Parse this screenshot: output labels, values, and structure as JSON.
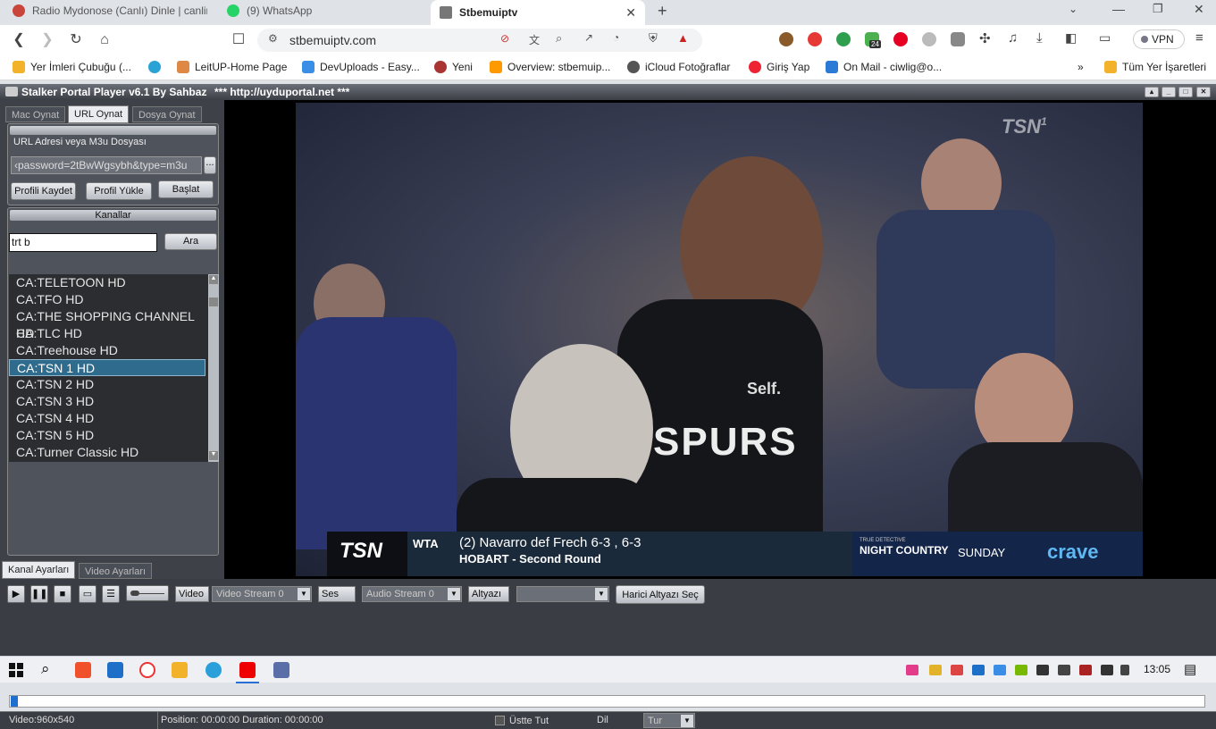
{
  "browser": {
    "tabs": [
      {
        "title": "Radio Mydonose (Canlı) Dinle | canlira",
        "active": false
      },
      {
        "title": "(9) WhatsApp",
        "active": false
      },
      {
        "title": "Stbemuiptv",
        "active": true
      }
    ],
    "url": "stbemuiptv.com",
    "vpn_label": "VPN",
    "badge_count": "24",
    "bookmarks": [
      "Yer İmleri Çubuğu (...",
      "LeitUP-Home Page",
      "DevUploads - Easy...",
      "Yeni",
      "Overview: stbemuip...",
      "iCloud Fotoğraflar",
      "Giriş Yap",
      "On Mail - ciwlig@o..."
    ],
    "bookmarks_more": "»",
    "all_bookmarks": "Tüm Yer İşaretleri"
  },
  "app": {
    "title": "Stalker Portal Player v6.1 By Sahbaz",
    "subtitle": "*** http://uyduportal.net ***",
    "tabs": [
      "Mac Oynat",
      "URL Oynat",
      "Dosya Oynat"
    ],
    "url_section_label": "URL Adresi veya M3u Dosyası",
    "url_value": "‹password=2tBwWgsybh&type=m3u",
    "browse_button": "...",
    "buttons": {
      "save_profile": "Profili Kaydet",
      "load_profile": "Profil Yükle",
      "start": "Başlat"
    },
    "channels_header": "Kanallar",
    "search_value": "trt b",
    "search_button": "Ara",
    "channels": [
      "CA:TELETOON HD",
      "CA:TFO HD",
      "CA:THE SHOPPING CHANNEL HD",
      "CA:TLC HD",
      "CA:Treehouse HD",
      "CA:TSN 1 HD",
      "CA:TSN 2 HD",
      "CA:TSN 3 HD",
      "CA:TSN 4 HD",
      "CA:TSN 5 HD",
      "CA:Turner Classic HD"
    ],
    "selected_channel_index": 5,
    "bottom_tabs": [
      "Kanal Ayarları",
      "Video Ayarları"
    ],
    "controls": {
      "video_label": "Video",
      "video_stream": "Video Stream 0",
      "audio_label": "Ses",
      "audio_stream": "Audio Stream 0",
      "subtitle_label": "Altyazı",
      "subtitle_value": "",
      "external_subtitle": "Harici Altyazı Seç"
    },
    "status": {
      "video_info": "Video:960x540",
      "position": "Position: 00:00:00 Duration: 00:00:00",
      "keep_on_top": "Üstte Tut",
      "language_label": "Dil",
      "language_value": "Tur"
    }
  },
  "broadcast": {
    "network_bug": "TSN",
    "network_bug_num": "1",
    "ticker_logo": "TSN",
    "league": "WTA",
    "headline": "(2) Navarro def Frech  6-3 , 6-3",
    "subline": "HOBART - Second Round",
    "promo_small": "TRUE DETECTIVE",
    "promo_show": "NIGHT COUNTRY",
    "promo_day": "SUNDAY",
    "promo_brand": "crave",
    "jersey_team": "SPURS",
    "jersey_sponsor": "Self."
  },
  "taskbar": {
    "time": "13:05"
  }
}
